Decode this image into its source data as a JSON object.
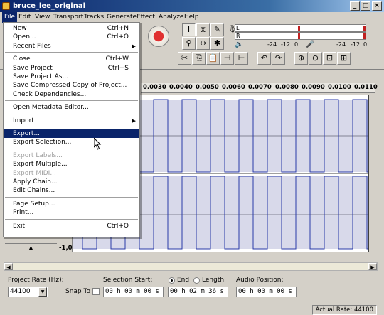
{
  "window": {
    "title": "bruce_lee_original",
    "min": "_",
    "max": "□",
    "close": "×"
  },
  "menubar": [
    "File",
    "Edit",
    "View",
    "Transport",
    "Tracks",
    "Generate",
    "Effect",
    "Analyze",
    "Help"
  ],
  "file_menu": [
    {
      "label": "New",
      "shortcut": "Ctrl+N"
    },
    {
      "label": "Open...",
      "shortcut": "Ctrl+O"
    },
    {
      "label": "Recent Files",
      "shortcut": "",
      "submenu": true
    },
    {
      "sep": true
    },
    {
      "label": "Close",
      "shortcut": "Ctrl+W"
    },
    {
      "label": "Save Project",
      "shortcut": "Ctrl+S"
    },
    {
      "label": "Save Project As...",
      "shortcut": ""
    },
    {
      "label": "Save Compressed Copy of Project...",
      "shortcut": ""
    },
    {
      "label": "Check Dependencies...",
      "shortcut": ""
    },
    {
      "sep": true
    },
    {
      "label": "Open Metadata Editor...",
      "shortcut": ""
    },
    {
      "sep": true
    },
    {
      "label": "Import",
      "shortcut": "",
      "submenu": true
    },
    {
      "sep": true
    },
    {
      "label": "Export...",
      "shortcut": "",
      "highlighted": true
    },
    {
      "label": "Export Selection...",
      "shortcut": ""
    },
    {
      "sep": true
    },
    {
      "label": "Export Labels...",
      "shortcut": "",
      "disabled": true
    },
    {
      "label": "Export Multiple...",
      "shortcut": ""
    },
    {
      "label": "Export MIDI...",
      "shortcut": "",
      "disabled": true
    },
    {
      "label": "Apply Chain...",
      "shortcut": ""
    },
    {
      "label": "Edit Chains...",
      "shortcut": ""
    },
    {
      "sep": true
    },
    {
      "label": "Page Setup...",
      "shortcut": ""
    },
    {
      "label": "Print...",
      "shortcut": ""
    },
    {
      "sep": true
    },
    {
      "label": "Exit",
      "shortcut": "Ctrl+Q"
    }
  ],
  "meters": {
    "left": "L",
    "right": "R",
    "scale_left": [
      "-24",
      "-12",
      "0"
    ],
    "scale_right": [
      "-24",
      "-12",
      "0"
    ]
  },
  "ruler": [
    "0.0030",
    "0.0040",
    "0.0050",
    "0.0060",
    "0.0070",
    "0.0080",
    "0.0090",
    "0.0100",
    "0.0110"
  ],
  "track": {
    "scale_bottom": "-1,0"
  },
  "selection_bar": {
    "project_rate_label": "Project Rate (Hz):",
    "project_rate": "44100",
    "snap_to_label": "Snap To",
    "selection_start_label": "Selection Start:",
    "end_label": "End",
    "length_label": "Length",
    "audio_position_label": "Audio Position:",
    "selection_start": "00 h 00 m 00 s",
    "selection_end": "00 h 02 m 36 s",
    "audio_position": "00 h 00 m 00 s"
  },
  "status": {
    "actual_rate": "Actual Rate: 44100"
  },
  "colors": {
    "waveform": "#2a3aa8",
    "waveform_fill": "#b8bad8",
    "menu_highlight": "#0a246a"
  }
}
